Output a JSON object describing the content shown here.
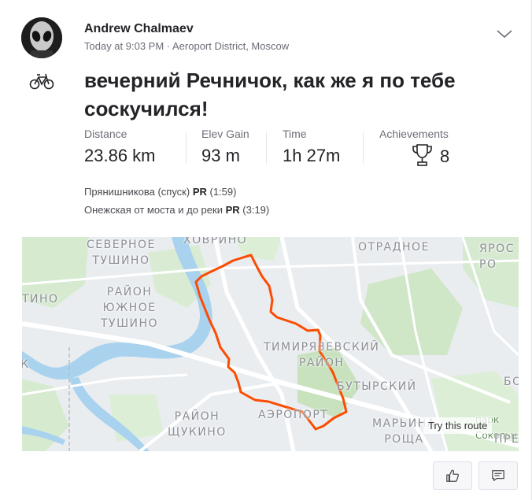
{
  "athlete": {
    "name": "Andrew Chalmaev",
    "meta": "Today at 9:03 PM · Aeroport District, Moscow"
  },
  "activity": {
    "type_icon": "bike-icon",
    "title": "вечерний Речничок, как же я по тебе соскучился!",
    "stats": {
      "distance": {
        "label": "Distance",
        "value": "23.86 km"
      },
      "elev_gain": {
        "label": "Elev Gain",
        "value": "93 m"
      },
      "time": {
        "label": "Time",
        "value": "1h 27m"
      },
      "achievements": {
        "label": "Achievements",
        "value": "8",
        "icon": "trophy-icon"
      }
    },
    "segments": [
      {
        "name": "Прянишникова (спуск)",
        "badge": "PR",
        "time": "(1:59)"
      },
      {
        "name": "Онежская от моста и до реки",
        "badge": "PR",
        "time": "(3:19)"
      }
    ]
  },
  "map": {
    "labels": {
      "khovrino": "ХОВРИНО",
      "severnoe_tushino": "СЕВЕРНОЕ\nТУШИНО",
      "otradnoe": "ОТРАДНОЕ",
      "yaros": "ЯРОС\nРО",
      "tino": "ТИНО",
      "yuzhnoe_tushino": "РАЙОН\nЮЖНОЕ\nТУШИНО",
      "timiryazevsky": "ТИМИРЯЗЕВСКИЙ\nРАЙОН",
      "butyrsky": "БУТЫРСКИЙ",
      "bo": "БО",
      "k": "К",
      "shchukino": "РАЙОН\nЩУКИНО",
      "aeroport": "АЭРОПОРТ",
      "maryina": "МАРЬИНА\nРОЩА",
      "park": "парк Сокольн",
      "pre": "ПРЕ"
    },
    "try_route_label": "Try this route",
    "route_color": "#fc4c02"
  },
  "actions": {
    "kudos_icon": "thumbs-up-icon",
    "comment_icon": "comment-icon"
  }
}
